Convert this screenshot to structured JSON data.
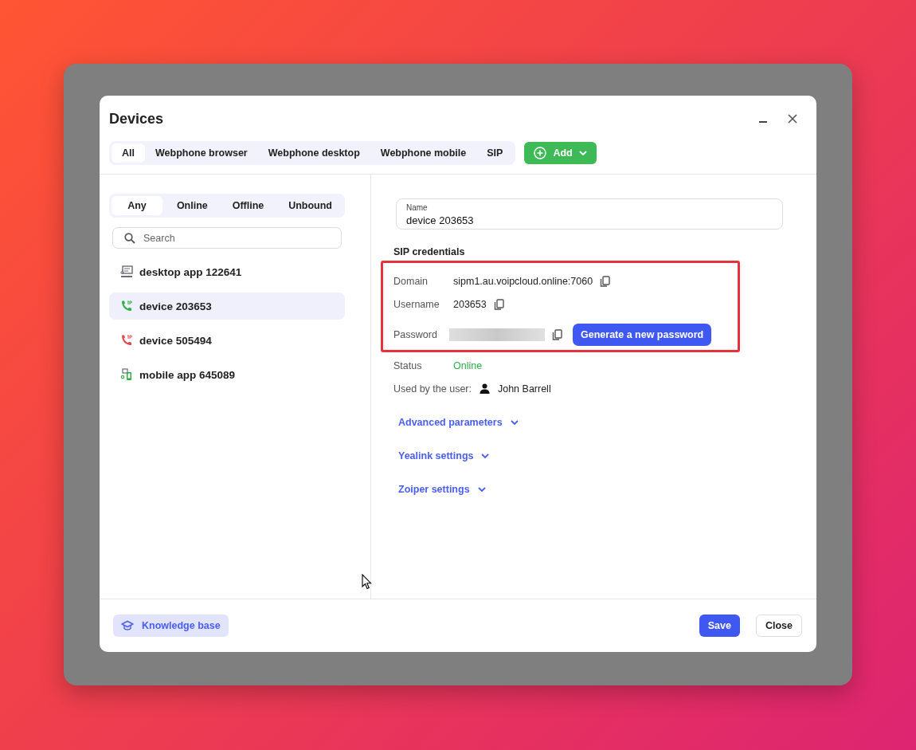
{
  "window": {
    "title": "Devices"
  },
  "type_tabs": [
    {
      "label": "All",
      "selected": true
    },
    {
      "label": "Webphone browser",
      "selected": false
    },
    {
      "label": "Webphone desktop",
      "selected": false
    },
    {
      "label": "Webphone mobile",
      "selected": false
    },
    {
      "label": "SIP",
      "selected": false
    }
  ],
  "add_button": {
    "label": "Add"
  },
  "status_filter": [
    {
      "label": "Any",
      "selected": true
    },
    {
      "label": "Online",
      "selected": false
    },
    {
      "label": "Offline",
      "selected": false
    },
    {
      "label": "Unbound",
      "selected": false
    }
  ],
  "search": {
    "placeholder": "Search"
  },
  "devices": [
    {
      "name": "desktop app 122641",
      "kind": "desktop",
      "color": "#6b6e76",
      "selected": false
    },
    {
      "name": "device 203653",
      "kind": "sip",
      "color": "#2fae4a",
      "selected": true
    },
    {
      "name": "device 505494",
      "kind": "sip",
      "color": "#e5484d",
      "selected": false
    },
    {
      "name": "mobile app 645089",
      "kind": "mobile",
      "color": "#2fae4a",
      "selected": false
    }
  ],
  "detail": {
    "name_field": {
      "label": "Name",
      "value": "device 203653"
    },
    "section_title": "SIP credentials",
    "credentials": [
      {
        "label": "Domain",
        "value": "sipm1.au.voipcloud.online:7060",
        "kind": "text"
      },
      {
        "label": "Username",
        "value": "203653",
        "kind": "text"
      },
      {
        "label": "Password",
        "kind": "masked",
        "action": "Generate a new password"
      }
    ],
    "status": {
      "label": "Status",
      "value": "Online",
      "color": "#2fae4a"
    },
    "user": {
      "label": "Used by the user:",
      "value": "John Barrell"
    },
    "expanders": [
      {
        "label": "Advanced parameters",
        "expanded": false
      },
      {
        "label": "Yealink settings",
        "expanded": false
      },
      {
        "label": "Zoiper settings",
        "expanded": false
      }
    ],
    "highlight": true
  },
  "footer": {
    "help": "Knowledge base",
    "buttons": [
      {
        "label": "Save",
        "kind": "primary"
      },
      {
        "label": "Close",
        "kind": "secondary"
      }
    ]
  }
}
